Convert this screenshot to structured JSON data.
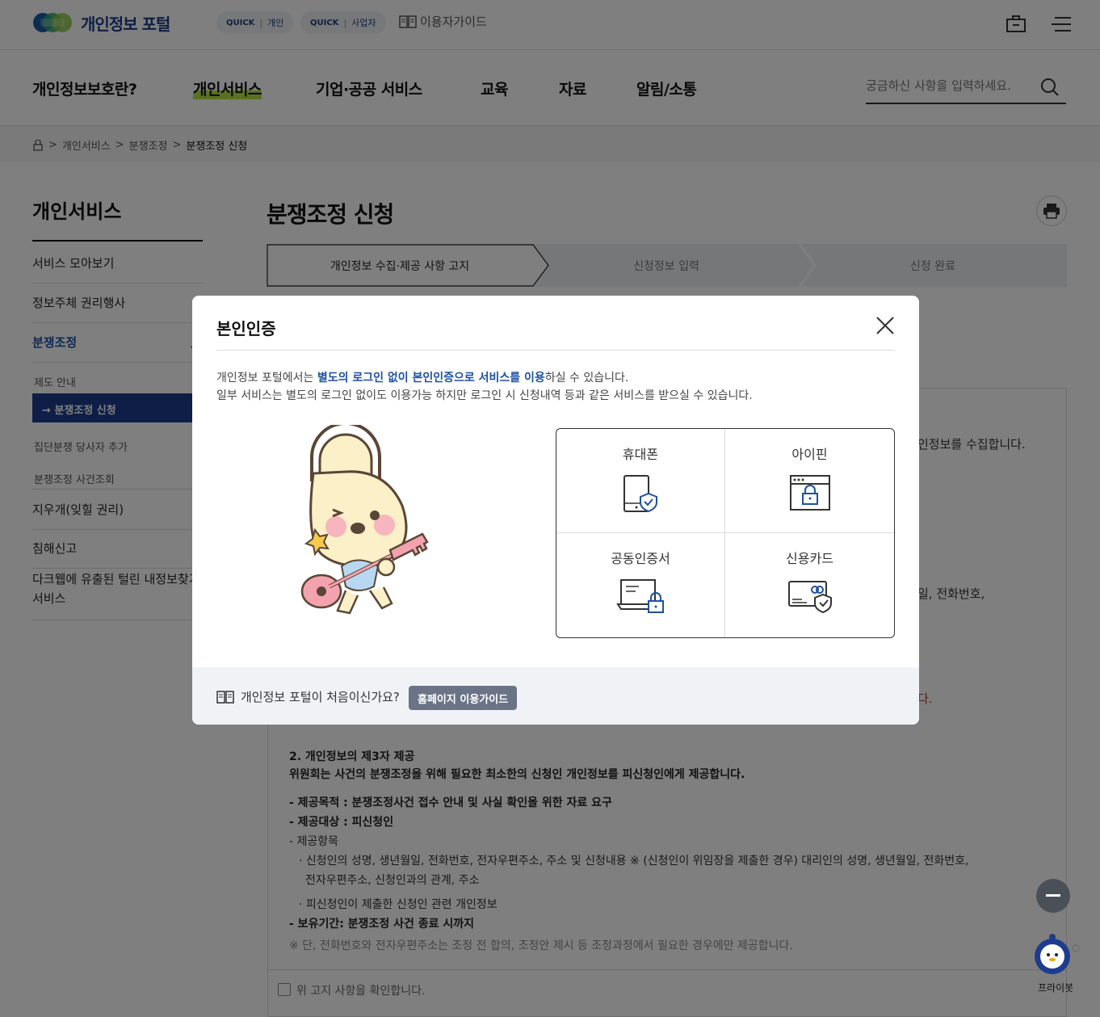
{
  "header": {
    "logo_text": "개인정보 포털",
    "quick1": {
      "tag": "QUICK",
      "label": "개인"
    },
    "quick2": {
      "tag": "QUICK",
      "label": "사업자"
    },
    "guide": "이용자가이드",
    "icons": [
      "lock-icon",
      "menu-icon"
    ]
  },
  "gnb": {
    "items": [
      "개인정보보호란?",
      "개인서비스",
      "기업·공공 서비스",
      "교육",
      "자료",
      "알림/소통"
    ],
    "active": "개인서비스",
    "search_placeholder": "궁금하신 사항을 입력하세요."
  },
  "breadcrumb": [
    "개인서비스",
    "분쟁조정",
    "분쟁조정 신청"
  ],
  "sidebar": {
    "title": "개인서비스",
    "items": [
      "서비스 모아보기",
      "정보주체 권리행사",
      "분쟁조정",
      "지우개(잊힐 권리)",
      "침해신고",
      "다크웹에 유출된 털린 내정보찾기 서비스"
    ],
    "subitems": [
      "제도 안내",
      "분쟁조정 신청",
      "집단분쟁 당사자 추가",
      "분쟁조정 사건조회"
    ],
    "selected_arrow": "→"
  },
  "page": {
    "title": "분쟁조정 신청",
    "steps": [
      "개인정보 수집·제공 사항 고지",
      "신청정보 입력",
      "신청 완료"
    ],
    "peek": {
      "r1": "인정보를 수집합니다.",
      "r2": "일, 전화번호,",
      "r3": "다."
    },
    "section2_title": "2. 개인정보의 제3자 제공",
    "section2_desc": "위원회는 사건의 분쟁조정을 위해 필요한 최소한의 신청인 개인정보를 피신청인에게 제공합니다.",
    "purpose": "- 제공목적 : 분쟁조정사건 접수 안내 및 사실 확인을 위한 자료 요구",
    "target": "- 제공대상 : 피신청인",
    "items_label": "- 제공항목",
    "item1a": "· 신청인의 성명, 생년월일, 전화번호, 전자우편주소, 주소 및 신청내용 ※ (신청인이 위임장을 제출한 경우) 대리인의 성명, 생년월일, 전화번호,",
    "item1b": "전자우편주소, 신청인과의 관계, 주소",
    "item2": "· 피신청인이 제출한 신청인 관련 개인정보",
    "retention": "- 보유기간: 분쟁조정 사건 종료 시까지",
    "note": "※ 단, 전화번호와 전자우편주소는 조정 전 합의, 조정안 제시 등 조정과정에서 필요한 경우에만 제공합니다.",
    "confirm": "위 고지 사항을 확인합니다."
  },
  "modal": {
    "title": "본인인증",
    "desc1_pre": "개인정보 포털에서는 ",
    "desc1_hl": "별도의 로그인 없이 본인인증으로 서비스를 이용",
    "desc1_post": "하실 수 있습니다.",
    "desc2": "일부 서비스는 별도의 로그인 없이도 이용가능 하지만 로그인 시 신청내역 등과 같은 서비스를 받으실 수 있습니다.",
    "options": [
      "휴대폰",
      "아이핀",
      "공동인증서",
      "신용카드"
    ],
    "footer_text": "개인정보 포털이 처음이신가요?",
    "footer_button": "홈페이지 이용가이드"
  },
  "bot_label": "프라이봇"
}
